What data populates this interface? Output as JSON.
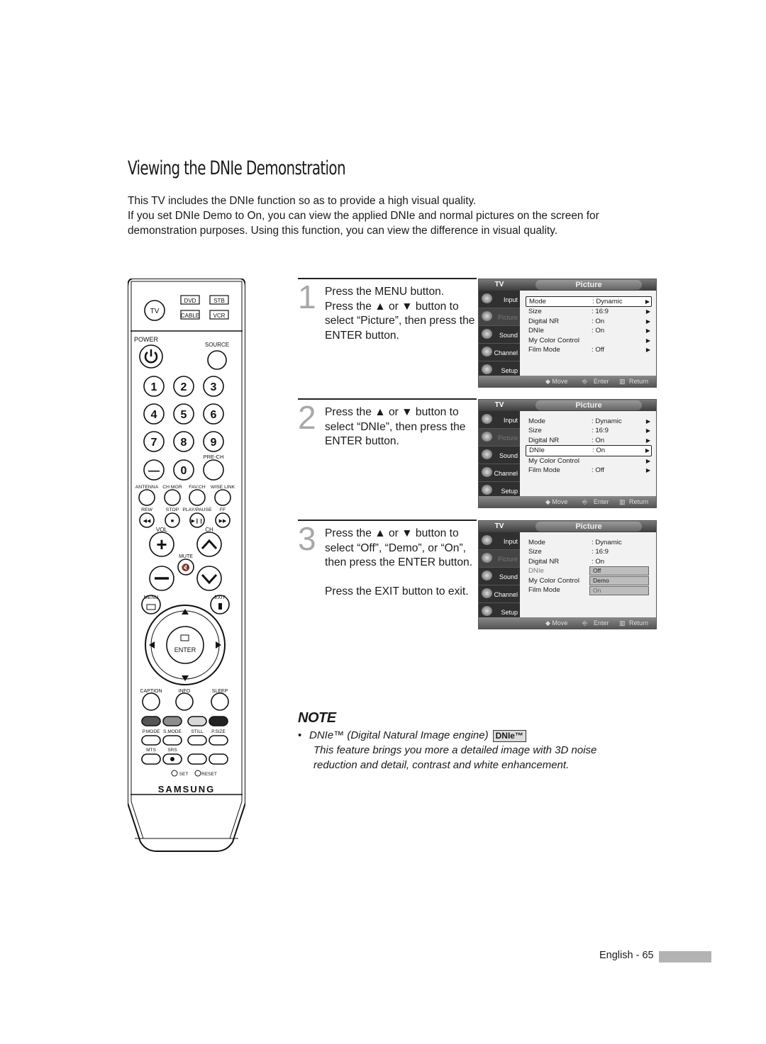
{
  "page": {
    "title": "Viewing the DNIe Demonstration",
    "intro": [
      "This TV includes the DNIe function so as to provide a high visual quality.",
      "If you set DNIe Demo to On, you can view the applied DNIe and normal pictures on the screen for demonstration purposes. Using this function, you can view the difference in visual quality."
    ],
    "footer": "English - 65"
  },
  "steps": [
    {
      "num": "1",
      "lines": [
        "Press the MENU button.",
        "Press the ▲ or ▼ button to select “Picture”, then press the ENTER button."
      ]
    },
    {
      "num": "2",
      "lines": [
        "Press the ▲ or ▼ button to select “DNIe”, then press the ENTER button."
      ]
    },
    {
      "num": "3",
      "lines": [
        "Press the ▲ or ▼ button to select “Off”, “Demo”, or “On”, then press the ENTER button."
      ],
      "extra": "Press the EXIT button to exit."
    }
  ],
  "osd": {
    "tv_label": "TV",
    "menu_title": "Picture",
    "side_menu": [
      "Input",
      "Picture",
      "Sound",
      "Channel",
      "Setup"
    ],
    "side_icons": [
      "input-icon",
      "picture-icon",
      "sound-icon",
      "channel-icon",
      "setup-icon"
    ],
    "items": [
      {
        "label": "Mode",
        "value": ": Dynamic"
      },
      {
        "label": "Size",
        "value": ": 16:9"
      },
      {
        "label": "Digital NR",
        "value": ": On"
      },
      {
        "label": "DNIe",
        "value": ": On"
      },
      {
        "label": "My Color Control",
        "value": ""
      },
      {
        "label": "Film Mode",
        "value": ": Off"
      }
    ],
    "dropdown_options": [
      "Off",
      "Demo",
      "On"
    ],
    "footer": {
      "move": "◆ Move",
      "enter": "Enter",
      "return": "Return"
    }
  },
  "remote": {
    "brand": "SAMSUNG",
    "mode_buttons": [
      "TV",
      "DVD",
      "STB",
      "CABLE",
      "VCR"
    ],
    "power": "POWER",
    "source": "SOURCE",
    "digits": [
      "1",
      "2",
      "3",
      "4",
      "5",
      "6",
      "7",
      "8",
      "9",
      "—",
      "0",
      ""
    ],
    "prech": "PRE-CH",
    "row_labels": [
      "ANTENNA",
      "CH MGR",
      "FAV.CH",
      "WISE LINK"
    ],
    "transport_labels": [
      "REW",
      "STOP",
      "PLAY/PAUSE",
      "FF"
    ],
    "vol": "VOL",
    "ch": "CH",
    "mute": "MUTE",
    "menu": "MENU",
    "exit": "EXIT",
    "enter": "ENTER",
    "func_labels": [
      "CAPTION",
      "INFO",
      "SLEEP"
    ],
    "color_labels": [
      "P.MODE",
      "S.MODE",
      "STILL",
      "P.SIZE"
    ],
    "bottom_labels": [
      "MTS",
      "SRS"
    ],
    "set": "SET",
    "reset": "RESET"
  },
  "note": {
    "heading": "NOTE",
    "bullet": "DNIe™ (Digital Natural Image engine)",
    "badge": "DNIe™",
    "text": "This feature brings you more a detailed image with 3D noise reduction and detail, contrast and white enhancement."
  }
}
